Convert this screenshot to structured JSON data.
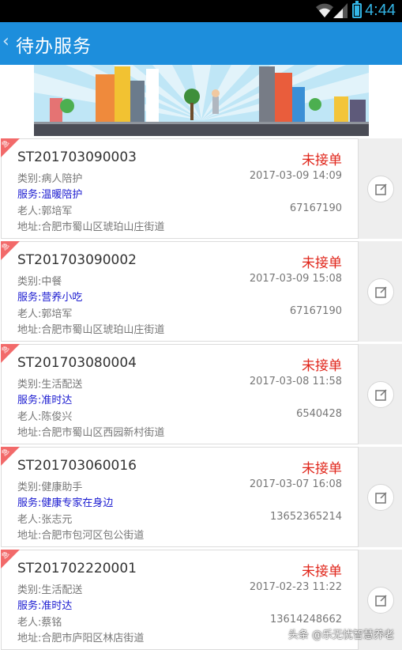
{
  "status_bar": {
    "time": "4:44"
  },
  "app_bar": {
    "back_glyph": "‹",
    "title": "待办服务"
  },
  "orders": [
    {
      "urgent_label": "急",
      "id": "ST201703090003",
      "status": "未接单",
      "category": "类别:病人陪护",
      "datetime": "2017-03-09 14:09",
      "service": "服务:温暖陪护",
      "elder": "老人:郭培军",
      "phone": "67167190",
      "address": "地址:合肥市蜀山区琥珀山庄街道"
    },
    {
      "urgent_label": "急",
      "id": "ST201703090002",
      "status": "未接单",
      "category": "类别:中餐",
      "datetime": "2017-03-09 15:08",
      "service": "服务:营养小吃",
      "elder": "老人:郭培军",
      "phone": "67167190",
      "address": "地址:合肥市蜀山区琥珀山庄街道"
    },
    {
      "urgent_label": "急",
      "id": "ST201703080004",
      "status": "未接单",
      "category": "类别:生活配送",
      "datetime": "2017-03-08 11:58",
      "service": "服务:准时达",
      "elder": "老人:陈俊兴",
      "phone": "6540428",
      "address": "地址:合肥市蜀山区西园新村街道"
    },
    {
      "urgent_label": "急",
      "id": "ST201703060016",
      "status": "未接单",
      "category": "类别:健康助手",
      "datetime": "2017-03-07 16:08",
      "service": "服务:健康专家在身边",
      "elder": "老人:张志元",
      "phone": "13652365214",
      "address": "地址:合肥市包河区包公街道"
    },
    {
      "urgent_label": "急",
      "id": "ST201702220001",
      "status": "未接单",
      "category": "类别:生活配送",
      "datetime": "2017-02-23 11:22",
      "service": "服务:准时达",
      "elder": "老人:蔡铭",
      "phone": "13614248662",
      "address": "地址:合肥市庐阳区林店街道"
    }
  ],
  "watermark": "头条 @乐无忧智慧养老",
  "colors": {
    "app_bar": "#1d8edc",
    "status_text": "#e0261b",
    "service_text": "#1a1ad0",
    "urgent_corner": "#f26a6a"
  },
  "icons": {
    "wifi": "wifi-icon",
    "signal": "signal-icon",
    "battery": "battery-icon",
    "back": "back-chevron-icon",
    "edit": "edit-icon"
  }
}
